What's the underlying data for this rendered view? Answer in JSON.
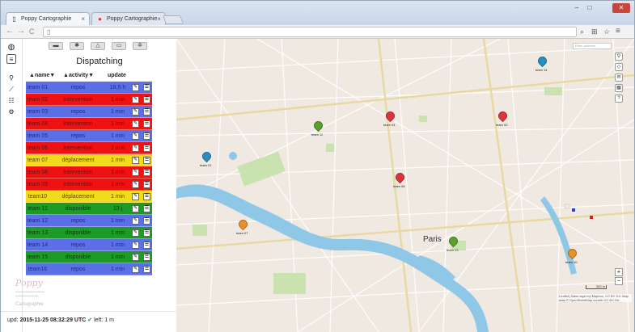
{
  "browser": {
    "tabs": [
      {
        "title": "Poppy Cartographie",
        "active": true
      },
      {
        "title": "Poppy Cartographie",
        "active": false
      }
    ],
    "close_glyph": "×",
    "window_controls": [
      "–",
      "□",
      "✕"
    ],
    "nav": {
      "back": "←",
      "forward": "→",
      "reload": "C"
    },
    "toolbar_icons": [
      "search-icon",
      "translate-icon",
      "star-icon",
      "menu-icon"
    ]
  },
  "sidebar": {
    "side_icons": [
      "globe-icon",
      "list-icon",
      "pin-icon",
      "chart-icon",
      "table-icon",
      "gear-icon"
    ],
    "top_buttons": [
      "car-icon",
      "gear-icon",
      "bell-icon",
      "file-icon",
      "cog-icon"
    ],
    "title": "Dispatching",
    "columns": {
      "name": "name",
      "activity": "activity",
      "update": "update"
    },
    "sort_glyphs": {
      "asc": "▲",
      "desc": "▼"
    },
    "teams": [
      {
        "name": "team 01",
        "activity": "repos",
        "update": "18,5 h",
        "color": "blue"
      },
      {
        "name": "team 02",
        "activity": "intervention",
        "update": "1 min",
        "color": "red"
      },
      {
        "name": "team 03",
        "activity": "repos",
        "update": "1 min",
        "color": "blue"
      },
      {
        "name": "team 04",
        "activity": "intervention",
        "update": "1 min",
        "color": "red"
      },
      {
        "name": "team 05",
        "activity": "repos",
        "update": "1 min",
        "color": "blue"
      },
      {
        "name": "team 06",
        "activity": "intervention",
        "update": "1 min",
        "color": "red"
      },
      {
        "name": "team 07",
        "activity": "déplacement",
        "update": "1 min",
        "color": "yellow"
      },
      {
        "name": "team 08",
        "activity": "intervention",
        "update": "1 min",
        "color": "red"
      },
      {
        "name": "team 09",
        "activity": "intervention",
        "update": "1 min",
        "color": "red"
      },
      {
        "name": "team10",
        "activity": "déplacement",
        "update": "1 min",
        "color": "yellow"
      },
      {
        "name": "team 11",
        "activity": "disponible",
        "update": "13 j",
        "color": "green"
      },
      {
        "name": "team 12",
        "activity": "repos",
        "update": "1 min",
        "color": "blue"
      },
      {
        "name": "team 13",
        "activity": "disponible",
        "update": "1 min",
        "color": "green"
      },
      {
        "name": "team 14",
        "activity": "repos",
        "update": "1 min",
        "color": "blue"
      },
      {
        "name": "team 15",
        "activity": "disponible",
        "update": "1 min",
        "color": "green"
      },
      {
        "name": "team16",
        "activity": "repos",
        "update": "1 min",
        "color": "blue"
      }
    ],
    "row_icons": {
      "edit": "✎",
      "list": "☰"
    },
    "logo": "Poppy",
    "carto_label": "Cartographie",
    "status": {
      "prefix": "upd:",
      "timestamp": "2015-11-25 08:32:29 UTC",
      "check": "✔",
      "left_label": "left: 1 m"
    }
  },
  "map": {
    "search_placeholder": "Enter address",
    "city_label": "Paris",
    "controls": [
      "pin-icon",
      "layers-icon",
      "mail-icon",
      "calendar-icon",
      "help-icon"
    ],
    "zoom_in": "+",
    "zoom_out": "−",
    "scale_label": "300 m",
    "attribution": "Leaflet | Base layer by Mapbox, CC BY 3.0. Map data © OpenStreetMap contrib CC-BY-SA",
    "markers": [
      {
        "label": "team 14",
        "color": "#2a8fbf"
      },
      {
        "label": "team 04",
        "color": "#d9363e"
      },
      {
        "label": "team 02",
        "color": "#d9363e"
      },
      {
        "label": "team 11",
        "color": "#5aa02c"
      },
      {
        "label": "team 01",
        "color": "#2a8fbf"
      },
      {
        "label": "team 06",
        "color": "#d9363e"
      },
      {
        "label": "team 07",
        "color": "#e8902b"
      },
      {
        "label": "team 13",
        "color": "#5aa02c"
      },
      {
        "label": "team 10",
        "color": "#e8902b"
      }
    ]
  }
}
